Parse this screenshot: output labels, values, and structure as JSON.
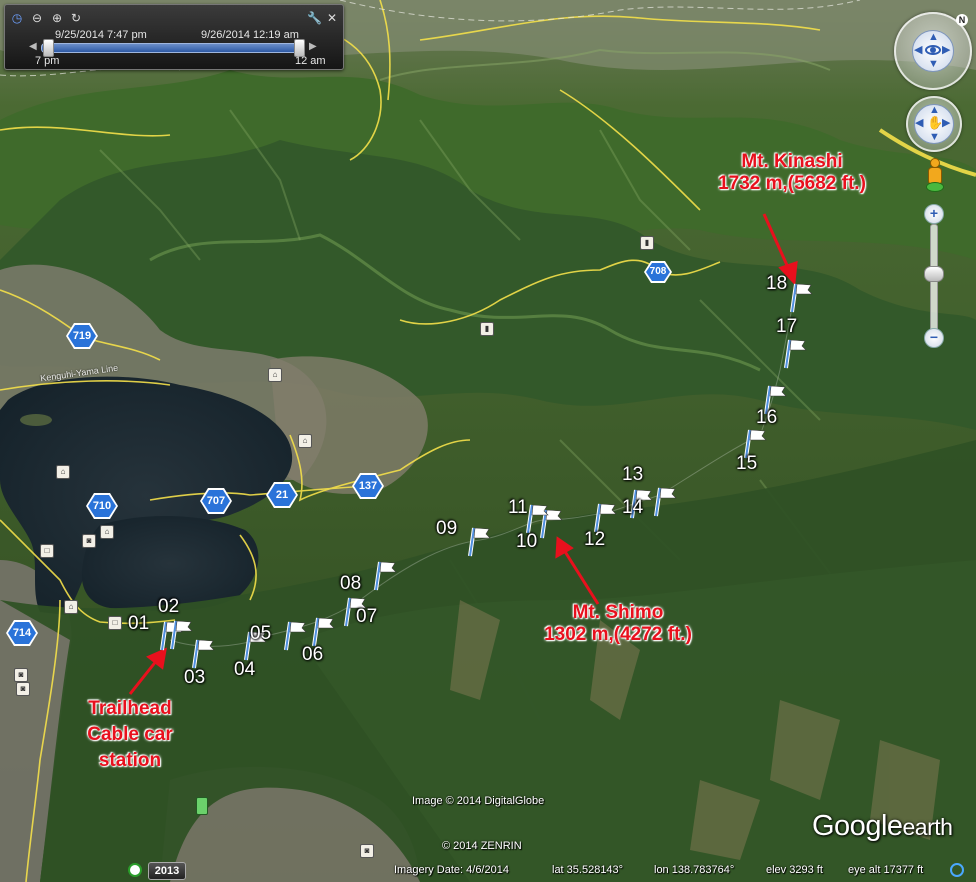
{
  "time_slider": {
    "start_datetime": "9/25/2014  7:47 pm",
    "end_datetime": "9/26/2014  12:19 am",
    "range_start": "7 pm",
    "range_end": "12 am"
  },
  "waypoints": [
    "01",
    "02",
    "03",
    "04",
    "05",
    "06",
    "07",
    "08",
    "09",
    "10",
    "11",
    "12",
    "13",
    "14",
    "15",
    "16",
    "17",
    "18"
  ],
  "annotations": {
    "kinashi": [
      "Mt. Kinashi",
      "1732 m,(5682 ft.)"
    ],
    "shimo": [
      "Mt. Shimo",
      "1302 m,(4272 ft.)"
    ],
    "trailhead": [
      "Trailhead",
      "Cable car",
      "station"
    ]
  },
  "road_shields": [
    "719",
    "710",
    "707",
    "21",
    "137",
    "708",
    "714"
  ],
  "road_label": "Kenguhi-Yama Line",
  "credits": {
    "imagery": "Image © 2014 DigitalGlobe",
    "zenrin": "© 2014 ZENRIN",
    "year_button": "2013",
    "logo_main": "Google",
    "logo_earth": "earth"
  },
  "status_bar": {
    "imagery_date": "Imagery Date: 4/6/2014",
    "lat": "lat   35.528143°",
    "lon": "lon   138.783764°",
    "elev": "elev   3293 ft",
    "eye_alt": "eye alt  17377 ft"
  },
  "nav": {
    "compass_north": "N",
    "zoom_in": "+",
    "zoom_out": "−"
  },
  "colors": {
    "annotation_red": "#e8101d",
    "lake": "#1a2a33",
    "road": "#f4e04a",
    "shield": "#2a73d9",
    "flag_pole": "#4f8fe0"
  },
  "icons": [
    "clock-icon",
    "zoom-out-icon",
    "zoom-in-icon",
    "replay-icon",
    "wrench-icon",
    "close-icon",
    "flag-icon",
    "pegman-icon",
    "camera-icon",
    "sun-icon"
  ]
}
